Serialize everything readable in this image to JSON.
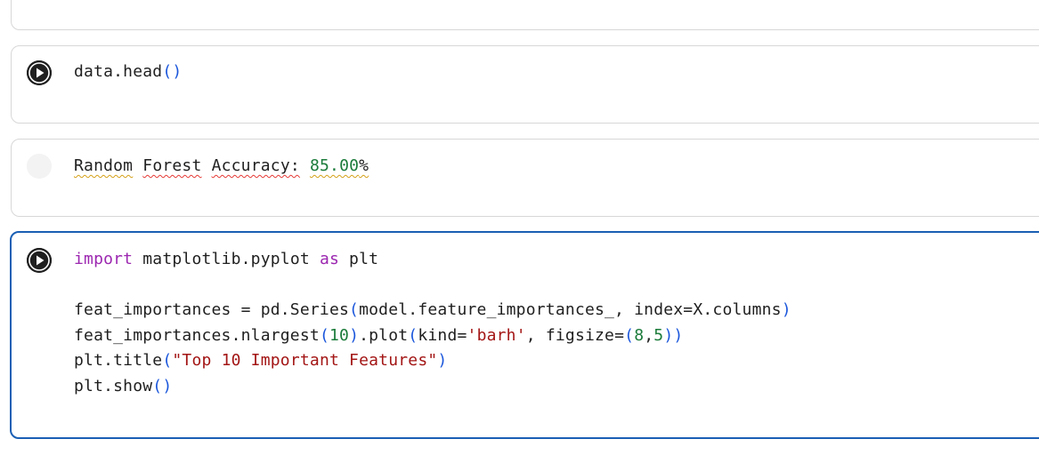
{
  "cells": {
    "c1": {
      "code": {
        "t1": "data.head",
        "p1": "(",
        "p2": ")"
      }
    },
    "c2": {
      "output": {
        "w1": "Random",
        "w2": "Forest",
        "w3": "Accuracy:",
        "num": "85.00",
        "pct": "%"
      }
    },
    "c3": {
      "lines": {
        "l1_kw1": "import",
        "l1_mod": " matplotlib.pyplot ",
        "l1_kw2": "as",
        "l1_alias": " plt",
        "l3_a": "feat_importances = pd.Series",
        "l3_p1": "(",
        "l3_b": "model.feature_importances_, index=X.columns",
        "l3_p2": ")",
        "l4_a": "feat_importances.nlargest",
        "l4_p1": "(",
        "l4_n1": "10",
        "l4_p2": ")",
        "l4_b": ".plot",
        "l4_p3": "(",
        "l4_c": "kind=",
        "l4_s1": "'barh'",
        "l4_d": ", figsize=",
        "l4_p4": "(",
        "l4_n2": "8",
        "l4_comma": ",",
        "l4_n3": "5",
        "l4_p5": ")",
        "l4_p6": ")",
        "l5_a": "plt.title",
        "l5_p1": "(",
        "l5_s": "\"Top 10 Important Features\"",
        "l5_p2": ")",
        "l6_a": "plt.show",
        "l6_p1": "(",
        "l6_p2": ")"
      }
    }
  },
  "icons": {
    "run": "play-icon"
  },
  "colors": {
    "keyword": "#9c27b0",
    "paren": "#1a56db",
    "number": "#1b7b3a",
    "string": "#a31515",
    "active_border": "#1a5fb4"
  }
}
